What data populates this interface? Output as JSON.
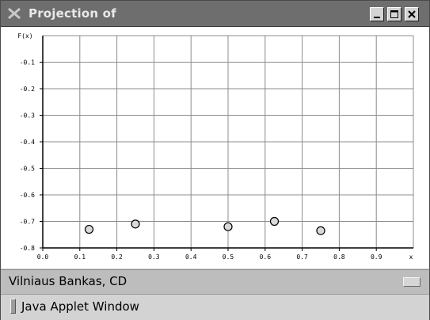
{
  "window": {
    "title": "Projection of",
    "app_icon": "x-icon",
    "buttons": [
      "minimize-icon",
      "maximize-icon",
      "close-icon"
    ]
  },
  "plot": {
    "ylabel": "F(x)",
    "xlabel": "x",
    "x_ticks": [
      "0.0",
      "0.1",
      "0.2",
      "0.3",
      "0.4",
      "0.5",
      "0.6",
      "0.7",
      "0.8",
      "0.9"
    ],
    "y_ticks": [
      "-0.1",
      "-0.2",
      "-0.3",
      "-0.4",
      "-0.5",
      "-0.6",
      "-0.7",
      "-0.8"
    ]
  },
  "chart_data": {
    "type": "scatter",
    "title": "",
    "xlabel": "x",
    "ylabel": "F(x)",
    "xlim": [
      0,
      1
    ],
    "ylim": [
      -0.8,
      0
    ],
    "grid": true,
    "points": [
      {
        "x": 0.125,
        "y": -0.73
      },
      {
        "x": 0.25,
        "y": -0.71
      },
      {
        "x": 0.5,
        "y": -0.72
      },
      {
        "x": 0.625,
        "y": -0.7
      },
      {
        "x": 0.75,
        "y": -0.735
      }
    ]
  },
  "selector": {
    "value": "Vilniaus Bankas, CD",
    "button_icon": "dropdown-icon"
  },
  "status": {
    "text": "Java Applet Window"
  },
  "colors": {
    "titlebar": "#6e6e6e",
    "plot_background": "#ffffff",
    "grid": "#8c8c8c",
    "marker_fill": "#d9d9d9"
  }
}
